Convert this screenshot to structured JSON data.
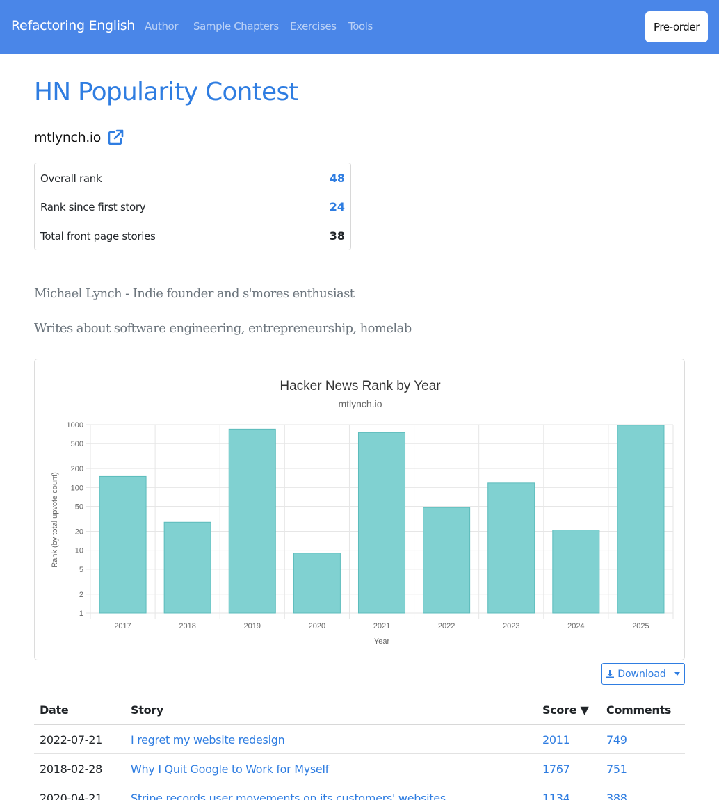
{
  "navbar": {
    "brand": "Refactoring English",
    "links": [
      "Author",
      "Sample Chapters",
      "Exercises",
      "Tools"
    ],
    "preorder_label": "Pre-order"
  },
  "page": {
    "title": "HN Popularity Contest",
    "domain": "mtlynch.io",
    "external_icon": "external-link-icon"
  },
  "stats": [
    {
      "label": "Overall rank",
      "value": "48",
      "linked": true
    },
    {
      "label": "Rank since first story",
      "value": "24",
      "linked": true
    },
    {
      "label": "Total front page stories",
      "value": "38",
      "linked": false
    }
  ],
  "bio": {
    "tagline": "Michael Lynch - Indie founder and s'mores enthusiast",
    "topics": "Writes about software engineering, entrepreneurship, homelab"
  },
  "chart_data": {
    "type": "bar",
    "title": "Hacker News Rank by Year",
    "subtitle": "mtlynch.io",
    "xlabel": "Year",
    "ylabel": "Rank (by total upvote count)",
    "yscale": "log",
    "ylim": [
      1,
      1000
    ],
    "yticks": [
      1,
      2,
      5,
      10,
      20,
      50,
      100,
      200,
      500,
      1000
    ],
    "categories": [
      "2017",
      "2018",
      "2019",
      "2020",
      "2021",
      "2022",
      "2023",
      "2024",
      "2025"
    ],
    "values": [
      150,
      28,
      850,
      9,
      750,
      48,
      118,
      21,
      980
    ],
    "color": "#80d1d1",
    "border_color": "#5cbcbc",
    "grid": true
  },
  "download": {
    "label": "Download",
    "icon": "download-icon",
    "caret_icon": "caret-down-icon"
  },
  "table": {
    "headers": {
      "date": "Date",
      "story": "Story",
      "score": "Score ▼",
      "comments": "Comments"
    },
    "rows": [
      {
        "date": "2022-07-21",
        "story": "I regret my website redesign",
        "score": "2011",
        "comments": "749"
      },
      {
        "date": "2018-02-28",
        "story": "Why I Quit Google to Work for Myself",
        "score": "1767",
        "comments": "751"
      },
      {
        "date": "2020-04-21",
        "story": "Stripe records user movements on its customers' websites",
        "score": "1134",
        "comments": "388"
      }
    ]
  }
}
